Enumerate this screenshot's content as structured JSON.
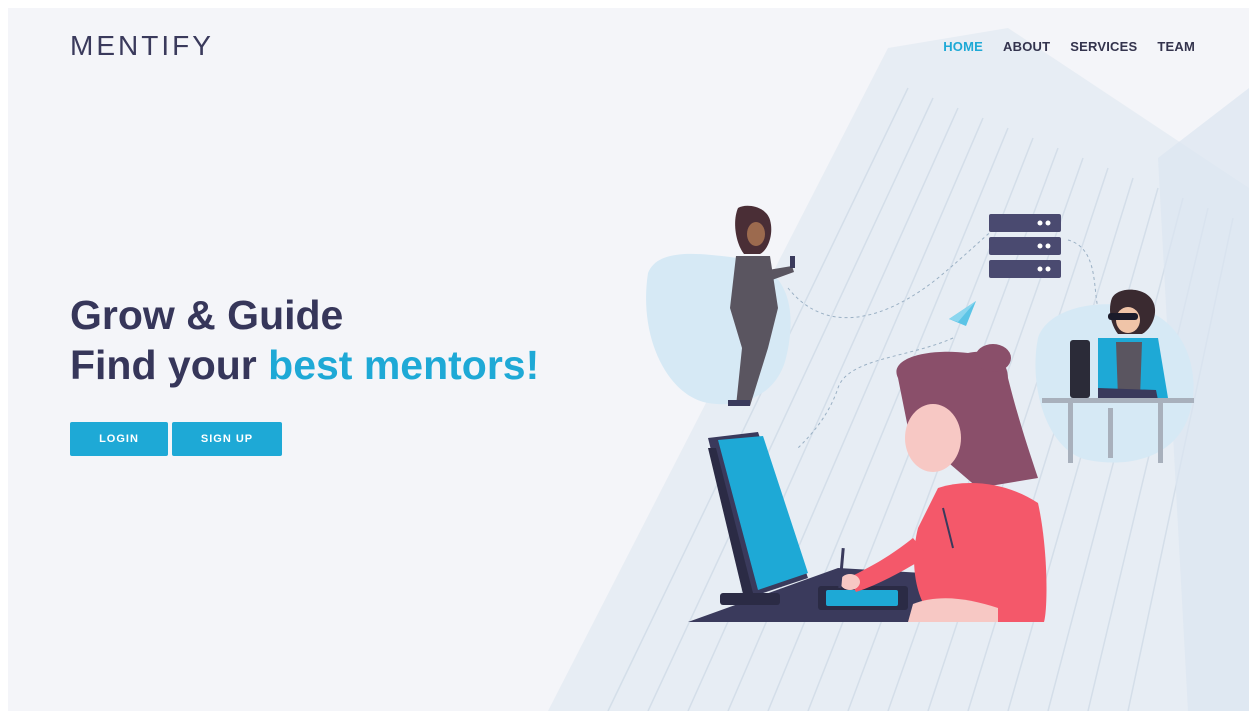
{
  "brand": {
    "logo_text": "MENTIFY"
  },
  "nav": {
    "items": [
      {
        "label": "HOME",
        "active": true
      },
      {
        "label": "ABOUT",
        "active": false
      },
      {
        "label": "SERVICES",
        "active": false
      },
      {
        "label": "TEAM",
        "active": false
      }
    ]
  },
  "hero": {
    "line1": "Grow & Guide",
    "line2_prefix": "Find your ",
    "line2_accent": "best mentors!"
  },
  "buttons": {
    "login": "LOGIN",
    "signup": "SIGN UP"
  },
  "colors": {
    "accent": "#1ea9d6",
    "text_dark": "#36365a",
    "background": "#f4f5f9",
    "shirt": "#f4586a",
    "hair": "#8a4f6a",
    "server": "#4a4a70"
  },
  "icons": [
    "paper-plane-icon",
    "server-icon"
  ]
}
